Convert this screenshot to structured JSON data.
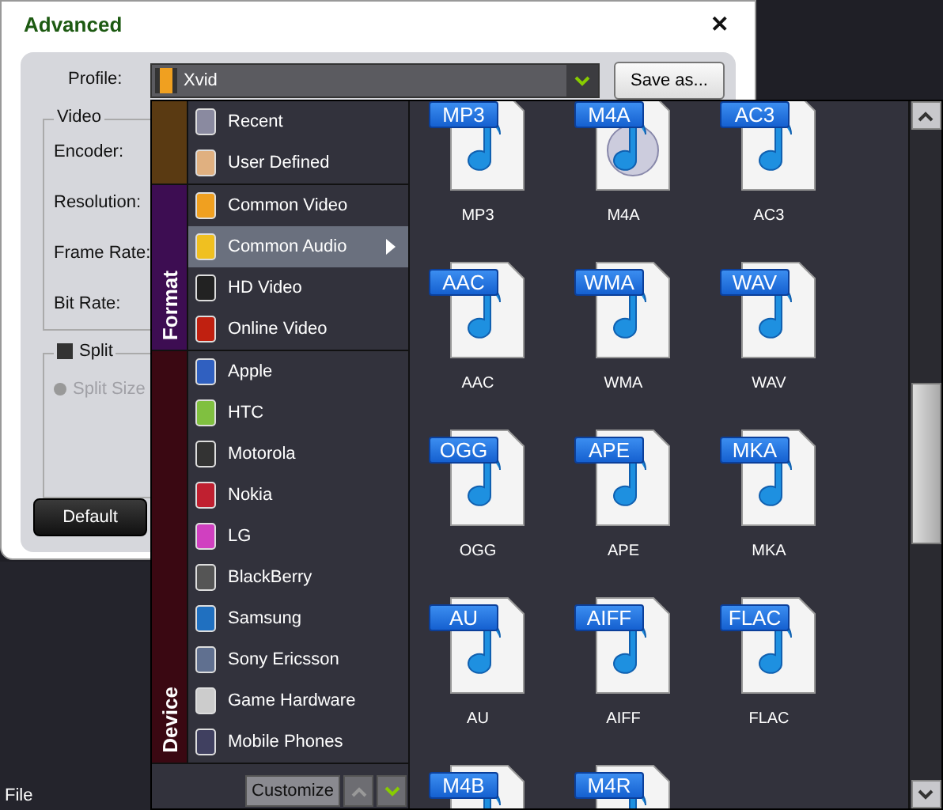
{
  "dialog": {
    "title": "Advanced",
    "close": "✕",
    "profile_label": "Profile:",
    "profile_value": "Xvid",
    "save_button": "Save as...",
    "video_group": {
      "title": "Video",
      "fields": [
        "Encoder:",
        "Resolution:",
        "Frame Rate:",
        "Bit Rate:"
      ]
    },
    "split_group": {
      "title": "Split",
      "checked": false,
      "option": {
        "label": "Split Size",
        "disabled": true
      }
    },
    "default_button": "Default"
  },
  "menu": {
    "file": "File"
  },
  "popup": {
    "sections": [
      {
        "color": "#5a3a12",
        "items": [
          {
            "label": "Recent",
            "selected": false
          },
          {
            "label": "User Defined",
            "selected": false
          }
        ]
      },
      {
        "label": "Format",
        "color": "#3d0d52",
        "items": [
          {
            "label": "Common Video",
            "selected": false
          },
          {
            "label": "Common Audio",
            "selected": true
          },
          {
            "label": "HD Video",
            "selected": false
          },
          {
            "label": "Online Video",
            "selected": false
          }
        ]
      },
      {
        "label": "Device",
        "color": "#3a0812",
        "items": [
          {
            "label": "Apple",
            "selected": false
          },
          {
            "label": "HTC",
            "selected": false
          },
          {
            "label": "Motorola",
            "selected": false
          },
          {
            "label": "Nokia",
            "selected": false
          },
          {
            "label": "LG",
            "selected": false
          },
          {
            "label": "BlackBerry",
            "selected": false
          },
          {
            "label": "Samsung",
            "selected": false
          },
          {
            "label": "Sony Ericsson",
            "selected": false
          },
          {
            "label": "Game Hardware",
            "selected": false
          },
          {
            "label": "Mobile Phones",
            "selected": false
          }
        ]
      }
    ],
    "customize_button": "Customize",
    "formats": [
      {
        "badge": "MP3",
        "label": "MP3"
      },
      {
        "badge": "M4A",
        "label": "M4A",
        "kind": "disc"
      },
      {
        "badge": "AC3",
        "label": "AC3"
      },
      {
        "badge": "AAC",
        "label": "AAC"
      },
      {
        "badge": "WMA",
        "label": "WMA"
      },
      {
        "badge": "WAV",
        "label": "WAV"
      },
      {
        "badge": "OGG",
        "label": "OGG"
      },
      {
        "badge": "APE",
        "label": "APE"
      },
      {
        "badge": "MKA",
        "label": "MKA"
      },
      {
        "badge": "AU",
        "label": "AU"
      },
      {
        "badge": "AIFF",
        "label": "AIFF"
      },
      {
        "badge": "FLAC",
        "label": "FLAC"
      },
      {
        "badge": "M4B"
      },
      {
        "badge": "M4R"
      }
    ]
  }
}
